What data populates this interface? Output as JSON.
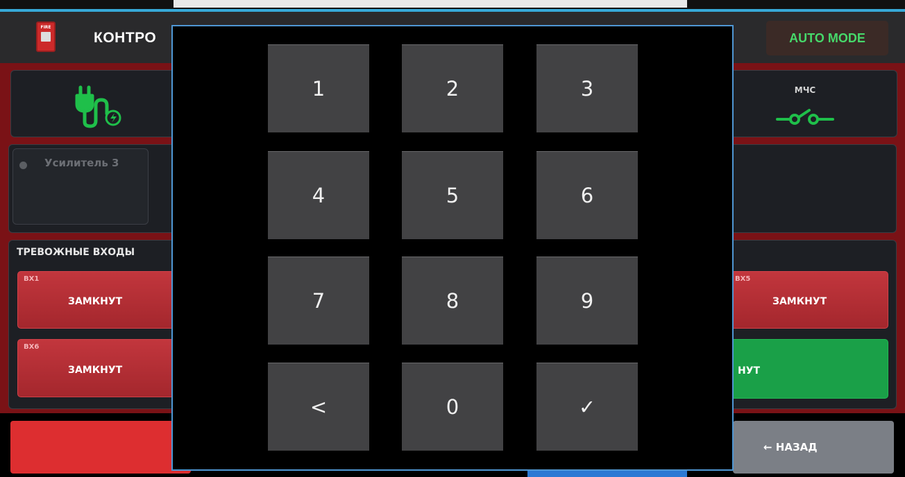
{
  "header": {
    "title": "КОНТРО",
    "fire_icon_label": "FIRE",
    "fire_icon": "fire-alarm-icon",
    "mode_badge": "AUTO MODE"
  },
  "status": {
    "power_icon": "power-plug-icon",
    "mchs_label": "МЧС",
    "mchs_icon": "switch-contact-icon"
  },
  "amplifiers": [
    {
      "label": "Усилитель 3"
    }
  ],
  "alarm_inputs": {
    "title": "ТРЕВОЖНЫЕ ВХОДЫ",
    "items": [
      {
        "code": "ВХ1",
        "state": "ЗАМКНУТ",
        "color": "#c2363d"
      },
      {
        "code": "ВХ6",
        "state": "ЗАМКНУТ",
        "color": "#c2363d"
      },
      {
        "code": "ВХ5",
        "state": "ЗАМКНУТ",
        "color": "#c2363d"
      },
      {
        "code": "",
        "state": "НУТ",
        "color": "#1aa048"
      }
    ]
  },
  "footer": {
    "back_label": "← НАЗАД"
  },
  "keypad": {
    "keys": [
      "1",
      "2",
      "3",
      "4",
      "5",
      "6",
      "7",
      "8",
      "9",
      "<",
      "0",
      "✓"
    ]
  },
  "colors": {
    "accent_blue": "#37a9d8",
    "alarm_red": "#7a1216",
    "auto_green": "#46d86a"
  }
}
